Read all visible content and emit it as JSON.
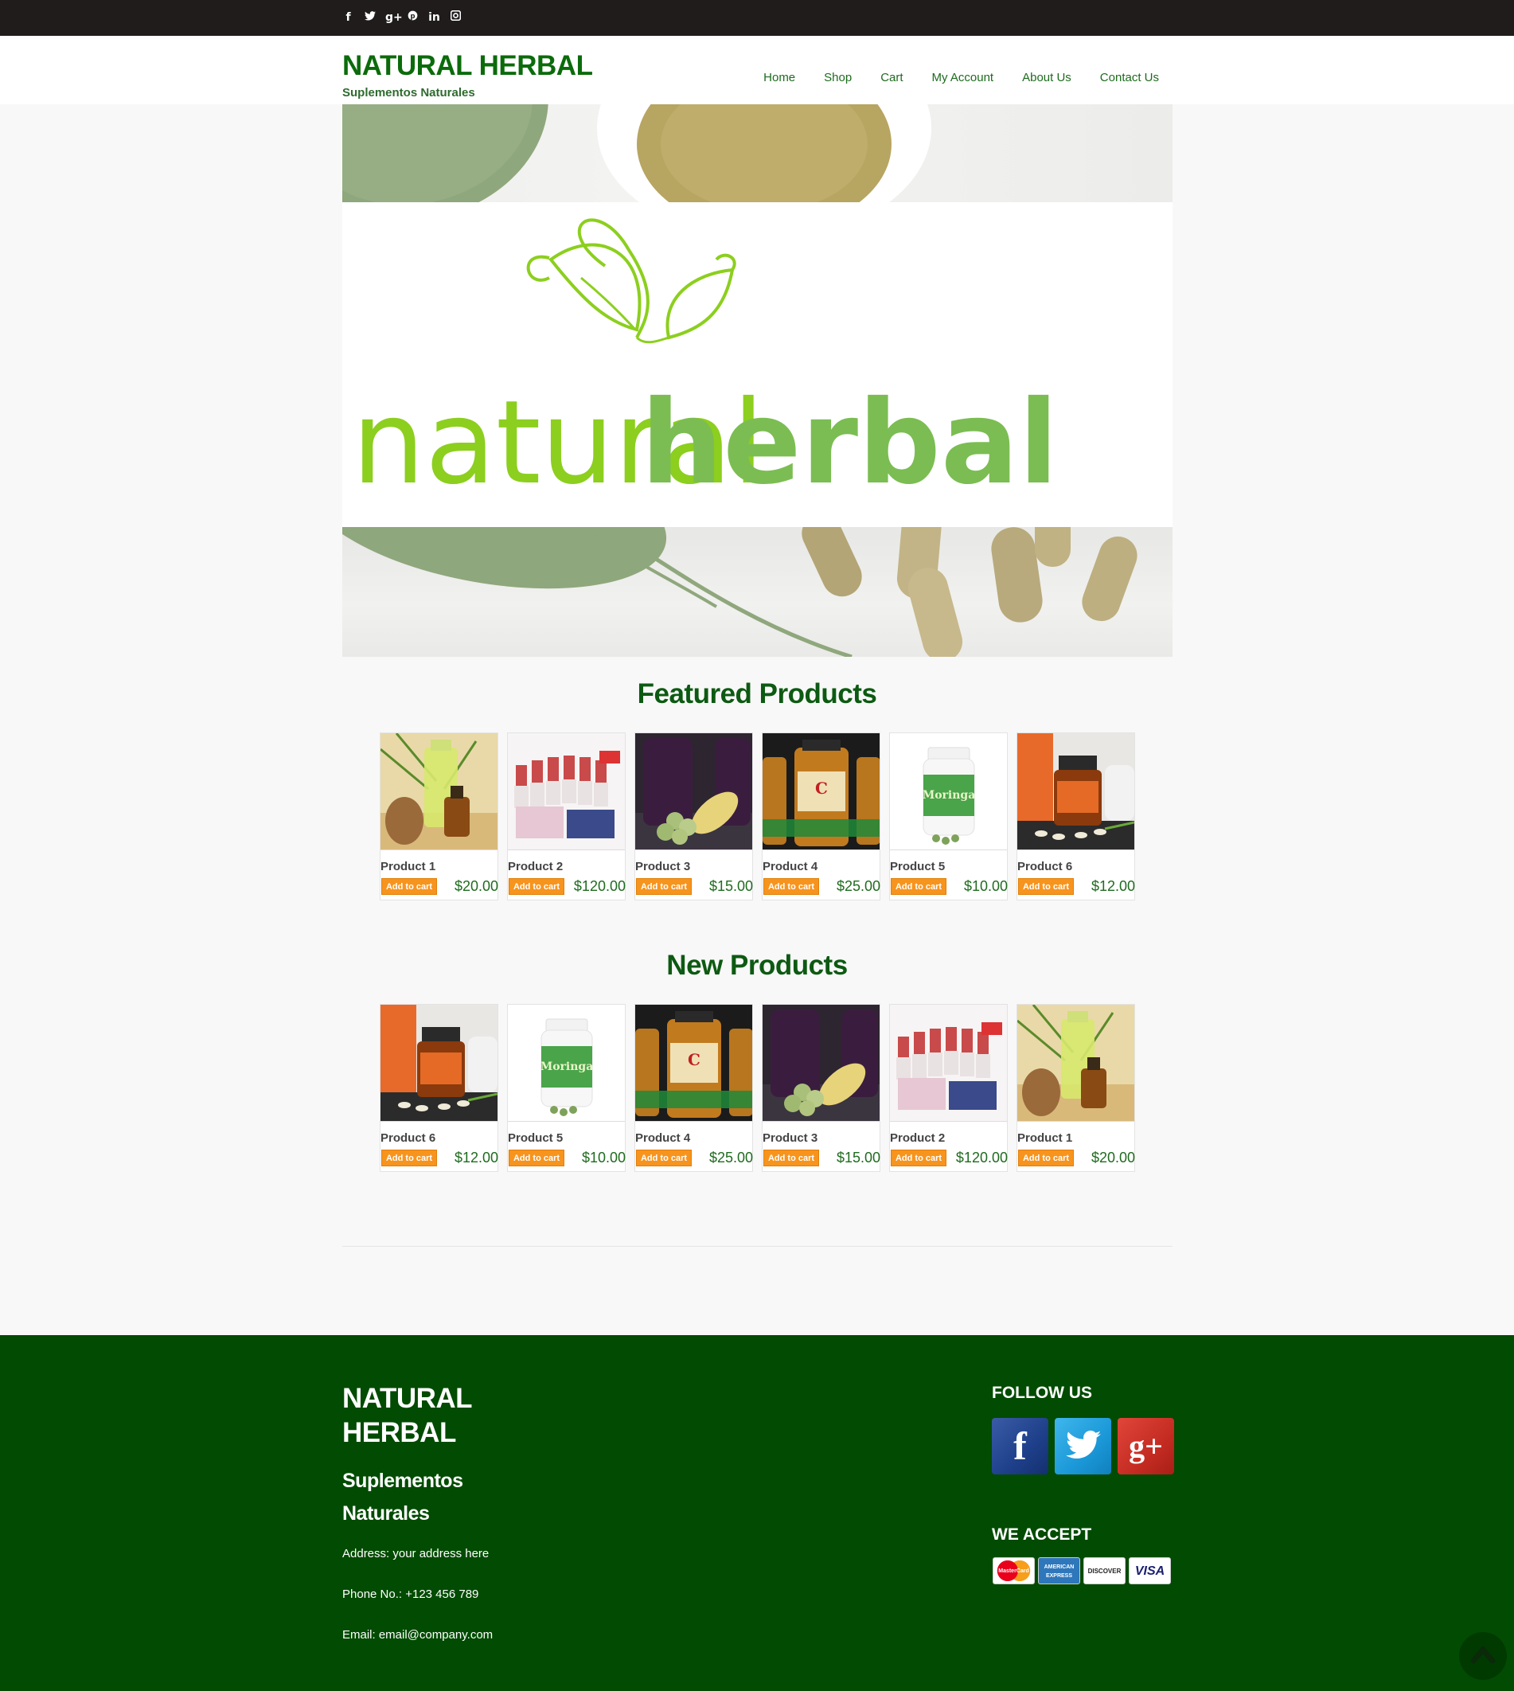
{
  "topbar": {
    "social": [
      {
        "icon": "facebook-icon",
        "glyph": "f"
      },
      {
        "icon": "twitter-icon",
        "glyph": "✶"
      },
      {
        "icon": "google-plus-icon",
        "glyph": "g+"
      },
      {
        "icon": "pinterest-icon",
        "glyph": "℗"
      },
      {
        "icon": "linkedin-icon",
        "glyph": "in"
      },
      {
        "icon": "instagram-icon",
        "glyph": "▣"
      }
    ]
  },
  "header": {
    "title": "NATURAL HERBAL",
    "tagline": "Suplementos Naturales",
    "nav": [
      "Home",
      "Shop",
      "Cart",
      "My Account",
      "About Us",
      "Contact Us"
    ]
  },
  "banner": {
    "logo_text_light": "natural",
    "logo_text_dark": "herbal"
  },
  "featured": {
    "title": "Featured Products",
    "products": [
      {
        "name": "Product 1",
        "price": "$20.00",
        "cart_label": "Add to cart",
        "thumb": "oil-bottle"
      },
      {
        "name": "Product 2",
        "price": "$120.00",
        "cart_label": "Add to cart",
        "thumb": "supplement-set"
      },
      {
        "name": "Product 3",
        "price": "$15.00",
        "cart_label": "Add to cart",
        "thumb": "juice-fruit"
      },
      {
        "name": "Product 4",
        "price": "$25.00",
        "cart_label": "Add to cart",
        "thumb": "vitamin-jars"
      },
      {
        "name": "Product 5",
        "price": "$10.00",
        "cart_label": "Add to cart",
        "thumb": "moringa-bottle"
      },
      {
        "name": "Product 6",
        "price": "$12.00",
        "cart_label": "Add to cart",
        "thumb": "amber-jar"
      }
    ]
  },
  "new": {
    "title": "New Products",
    "products": [
      {
        "name": "Product 6",
        "price": "$12.00",
        "cart_label": "Add to cart",
        "thumb": "amber-jar"
      },
      {
        "name": "Product 5",
        "price": "$10.00",
        "cart_label": "Add to cart",
        "thumb": "moringa-bottle"
      },
      {
        "name": "Product 4",
        "price": "$25.00",
        "cart_label": "Add to cart",
        "thumb": "vitamin-jars"
      },
      {
        "name": "Product 3",
        "price": "$15.00",
        "cart_label": "Add to cart",
        "thumb": "juice-fruit"
      },
      {
        "name": "Product 2",
        "price": "$120.00",
        "cart_label": "Add to cart",
        "thumb": "supplement-set"
      },
      {
        "name": "Product 1",
        "price": "$20.00",
        "cart_label": "Add to cart",
        "thumb": "oil-bottle"
      }
    ]
  },
  "footer": {
    "title": "NATURAL HERBAL",
    "tagline": "Suplementos Naturales",
    "address": "Address: your address here",
    "phone": "Phone No.: +123 456 789",
    "email": "Email: email@company.com",
    "follow_title": "FOLLOW US",
    "accept_title": "WE ACCEPT",
    "social_labels": [
      "f",
      "🐦",
      "g+"
    ],
    "cards": [
      "MasterCard",
      "AMERICAN EXPRESS",
      "DISCOVER",
      "VISA"
    ]
  },
  "colors": {
    "brand_green": "#0b6b0b",
    "footer_green": "#024b02",
    "cart_orange": "#f7941d",
    "logo_light_green": "#8ccf1e",
    "logo_dark_green": "#7bbd52"
  }
}
